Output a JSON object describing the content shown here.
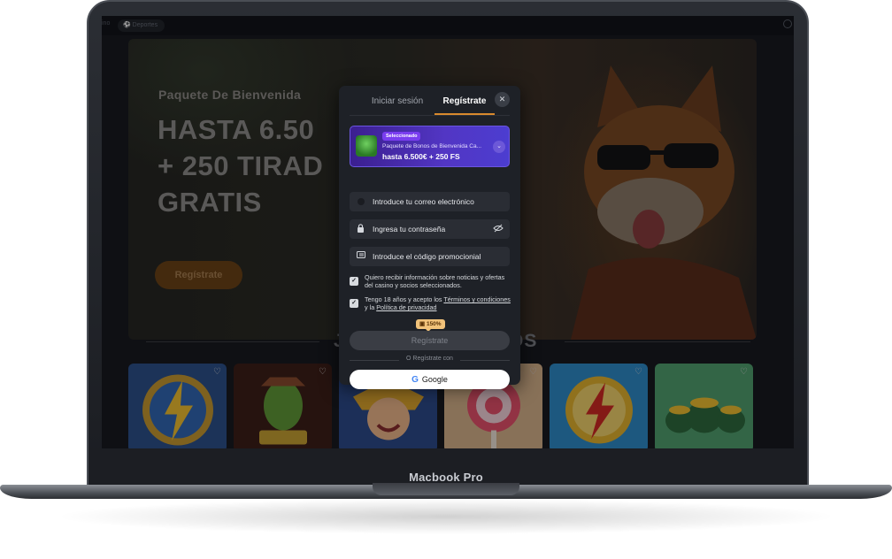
{
  "device": {
    "model_label": "Macbook Pro"
  },
  "site": {
    "topbar": {
      "left_text": "ino",
      "sports_label": "Deportes"
    },
    "hero": {
      "subtitle": "Paquete De Bienvenida",
      "title_lines": [
        "HASTA 6.50",
        "+ 250 TIRAD",
        "GRATIS"
      ],
      "cta_label": "Regístrate"
    },
    "section": {
      "title_left": "J",
      "title_right": "OS"
    },
    "games": [
      {
        "name": "lightning-coin",
        "bg": "#2a4f8a"
      },
      {
        "name": "wild-cactus",
        "bg": "#3b1c14"
      },
      {
        "name": "joker",
        "bg": "#2b4a8a"
      },
      {
        "name": "lollipop",
        "bg": "#d8b38a"
      },
      {
        "name": "red-lightning",
        "bg": "#2c8bc9"
      },
      {
        "name": "pots-of-gold",
        "bg": "#4fa06d"
      }
    ]
  },
  "modal": {
    "tabs": {
      "login": "Iniciar sesión",
      "register": "Regístrate"
    },
    "close_icon": "close-icon",
    "bonus": {
      "badge": "Seleccionado",
      "name": "Paquete de Bonos de Bienvenida Ca...",
      "value": "hasta 6.500€ + 250 FS"
    },
    "fields": {
      "email_placeholder": "Introduce tu correo electrónico",
      "password_placeholder": "Ingresa tu contraseña",
      "promo_placeholder": "Introduce el código promocionial"
    },
    "consents": {
      "marketing": "Quiero recibir información sobre noticias y ofertas del casino y socios seleccionados.",
      "terms_prefix": "Tengo 18 años y acepto los ",
      "terms_link_1": "Términos y condiciones",
      "terms_middle": " y la ",
      "terms_link_2": "Política de privacidad"
    },
    "promo_tag": "150%",
    "submit_label": "Regístrate",
    "or_text": "O Regístrate con",
    "google_label": "Google"
  },
  "colors": {
    "accent": "#d98a2d",
    "bonus_purple": "#5236c4",
    "modal_bg": "#1e2127"
  }
}
